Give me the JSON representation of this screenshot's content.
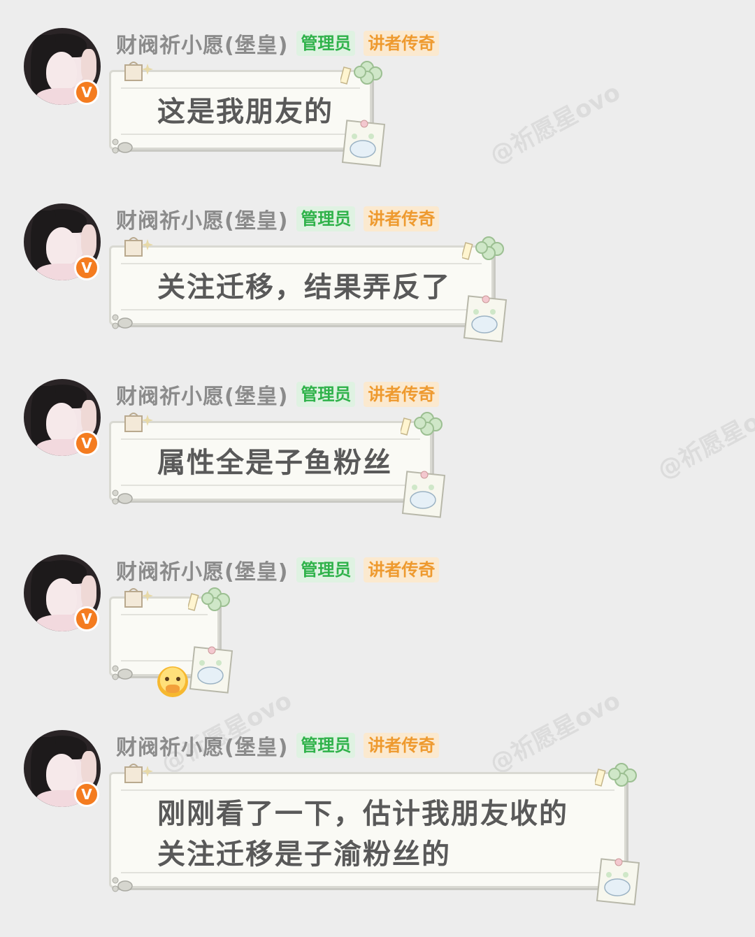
{
  "user": {
    "name": "财阀祈小愿(堡皇)",
    "tag_admin": "管理员",
    "tag_legend": "讲者传奇",
    "verify_badge": "V"
  },
  "watermark": "@祈愿星ovo",
  "messages": [
    {
      "text": "这是我朋友的"
    },
    {
      "text": "关注迁移，结果弄反了"
    },
    {
      "text": "属性全是子鱼粉丝"
    },
    {
      "text": "",
      "emoji": "crying-face-emoji"
    },
    {
      "text": "刚刚看了一下，估计我朋友收的\n关注迁移是子渝粉丝的"
    }
  ],
  "colors": {
    "background": "#ededed",
    "admin_tag": "#2fb24a",
    "legend_tag": "#ee9a2f",
    "verify_badge": "#f47c20"
  }
}
